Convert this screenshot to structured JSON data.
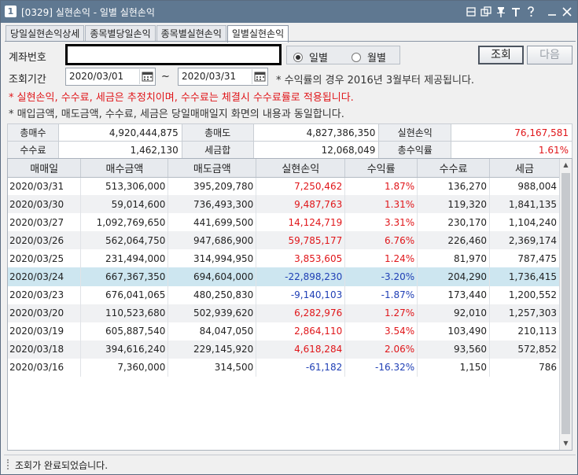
{
  "window": {
    "icon": "1",
    "title": "[0329] 실현손익 - 일별 실현손익",
    "title_buttons": [
      "restore-icon",
      "copy-icon",
      "pin-icon",
      "font-icon",
      "help-icon",
      "minimize-icon",
      "close-icon"
    ]
  },
  "tabs": [
    {
      "label": "당일실현손익상세",
      "active": false
    },
    {
      "label": "종목별당일손익",
      "active": false
    },
    {
      "label": "종목별실현손익",
      "active": false
    },
    {
      "label": "일별실현손익",
      "active": true
    }
  ],
  "form": {
    "account_label": "계좌번호",
    "account_value": "",
    "radio_daily": "일별",
    "radio_monthly": "월별",
    "radio_selected": "daily",
    "query_button": "조회",
    "next_button": "다음",
    "period_label": "조회기간",
    "date_from": "2020/03/01",
    "date_sep": "~",
    "date_to": "2020/03/31",
    "note_rate": "* 수익률의 경우 2016년 3월부터 제공됩니다."
  },
  "notices": {
    "red": "* 실현손익, 수수료, 세금은 추정치이며, 수수료는 체결시 수수료률로 적용됩니다.",
    "dark": "* 매입금액, 매도금액, 수수료, 세금은 당일매매일지 화면의 내용과 동일합니다."
  },
  "summary": {
    "total_buy_label": "총매수",
    "total_buy": "4,920,444,875",
    "total_sell_label": "총매도",
    "total_sell": "4,827,386,350",
    "realized_label": "실현손익",
    "realized": "76,167,581",
    "fee_label": "수수료",
    "fee": "1,462,130",
    "tax_label": "세금합",
    "tax": "12,068,049",
    "return_label": "총수익률",
    "return": "1.61%"
  },
  "grid": {
    "columns": [
      "매매일",
      "매수금액",
      "매도금액",
      "실현손익",
      "수익률",
      "수수료",
      "세금"
    ],
    "rows": [
      {
        "date": "2020/03/31",
        "buy": "513,306,000",
        "sell": "395,209,780",
        "pl": "7,250,462",
        "rate": "1.87%",
        "fee": "136,270",
        "tax": "988,004",
        "sign": "pos"
      },
      {
        "date": "2020/03/30",
        "buy": "59,014,600",
        "sell": "736,493,300",
        "pl": "9,487,763",
        "rate": "1.31%",
        "fee": "119,320",
        "tax": "1,841,135",
        "sign": "pos"
      },
      {
        "date": "2020/03/27",
        "buy": "1,092,769,650",
        "sell": "441,699,500",
        "pl": "14,124,719",
        "rate": "3.31%",
        "fee": "230,170",
        "tax": "1,104,240",
        "sign": "pos"
      },
      {
        "date": "2020/03/26",
        "buy": "562,064,750",
        "sell": "947,686,900",
        "pl": "59,785,177",
        "rate": "6.76%",
        "fee": "226,460",
        "tax": "2,369,174",
        "sign": "pos"
      },
      {
        "date": "2020/03/25",
        "buy": "231,494,000",
        "sell": "314,994,950",
        "pl": "3,853,605",
        "rate": "1.24%",
        "fee": "81,970",
        "tax": "787,475",
        "sign": "pos"
      },
      {
        "date": "2020/03/24",
        "buy": "667,367,350",
        "sell": "694,604,000",
        "pl": "-22,898,230",
        "rate": "-3.20%",
        "fee": "204,290",
        "tax": "1,736,415",
        "sign": "neg"
      },
      {
        "date": "2020/03/23",
        "buy": "676,041,065",
        "sell": "480,250,830",
        "pl": "-9,140,103",
        "rate": "-1.87%",
        "fee": "173,440",
        "tax": "1,200,552",
        "sign": "neg"
      },
      {
        "date": "2020/03/20",
        "buy": "110,523,680",
        "sell": "502,939,620",
        "pl": "6,282,976",
        "rate": "1.27%",
        "fee": "92,010",
        "tax": "1,257,303",
        "sign": "pos"
      },
      {
        "date": "2020/03/19",
        "buy": "605,887,540",
        "sell": "84,047,050",
        "pl": "2,864,110",
        "rate": "3.54%",
        "fee": "103,490",
        "tax": "210,113",
        "sign": "pos"
      },
      {
        "date": "2020/03/18",
        "buy": "394,616,240",
        "sell": "229,145,920",
        "pl": "4,618,284",
        "rate": "2.06%",
        "fee": "93,560",
        "tax": "572,852",
        "sign": "pos"
      },
      {
        "date": "2020/03/16",
        "buy": "7,360,000",
        "sell": "314,500",
        "pl": "-61,182",
        "rate": "-16.32%",
        "fee": "1,150",
        "tax": "786",
        "sign": "neg"
      }
    ],
    "selected_row": 5
  },
  "status": {
    "text": "조회가 완료되었습니다."
  }
}
